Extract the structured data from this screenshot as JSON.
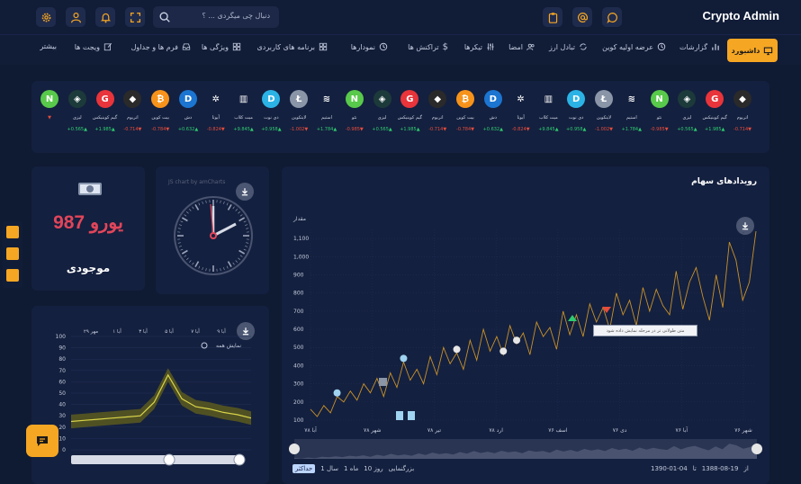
{
  "header": {
    "brand": "Crypto Admin",
    "search_placeholder": "دنبال چی میگردی ... ؟"
  },
  "nav": {
    "active": "داشبورد",
    "items": [
      "گزارشات",
      "عرضه اولیه کوین",
      "تبادل ارز",
      "امضا",
      "تیکرها",
      "تراکنش ها",
      "نمودارها",
      "برنامه های کاربردی",
      "ویژگی ها",
      "فرم ها و جداول",
      "ویجت ها",
      "بیشتر"
    ]
  },
  "coins": [
    {
      "name": "اتریوم",
      "change": "-0.714",
      "dir": "dn",
      "color": "#2a2a2a",
      "glyph": "◆"
    },
    {
      "name": "گیم کوینیکس",
      "change": "+1.985",
      "dir": "up",
      "color": "#e8343a",
      "glyph": "G"
    },
    {
      "name": "لیزی",
      "change": "+0.565",
      "dir": "up",
      "color": "#1c3a3a",
      "glyph": "◈"
    },
    {
      "name": "نئو",
      "change": "-0.985",
      "dir": "dn",
      "color": "#58c94a",
      "glyph": "N"
    },
    {
      "name": "استیم",
      "change": "+1.784",
      "dir": "up",
      "color": "#14203f",
      "glyph": "≋"
    },
    {
      "name": "لایتکوین",
      "change": "-1.002",
      "dir": "dn",
      "color": "#8a95a8",
      "glyph": "Ł"
    },
    {
      "name": "دی نوت",
      "change": "+0.958",
      "dir": "up",
      "color": "#2bb3e6",
      "glyph": "D"
    },
    {
      "name": "میت کلاب",
      "change": "+9.845",
      "dir": "up",
      "color": "#14203f",
      "glyph": "▥"
    },
    {
      "name": "آیوتا",
      "change": "-0.824",
      "dir": "dn",
      "color": "#14203f",
      "glyph": "✲"
    },
    {
      "name": "دش",
      "change": "+0.632",
      "dir": "up",
      "color": "#1b75d1",
      "glyph": "D"
    },
    {
      "name": "بیت کوین",
      "change": "-0.784",
      "dir": "dn",
      "color": "#f7931a",
      "glyph": "₿"
    },
    {
      "name": "اتریوم",
      "change": "-0.714",
      "dir": "dn",
      "color": "#2a2a2a",
      "glyph": "◆"
    },
    {
      "name": "گیم کوینیکس",
      "change": "+1.985",
      "dir": "up",
      "color": "#e8343a",
      "glyph": "G"
    },
    {
      "name": "لیزی",
      "change": "+0.565",
      "dir": "up",
      "color": "#1c3a3a",
      "glyph": "◈"
    },
    {
      "name": "نئو",
      "change": "-0.985",
      "dir": "dn",
      "color": "#58c94a",
      "glyph": "N"
    },
    {
      "name": "استیم",
      "change": "+1.784",
      "dir": "up",
      "color": "#14203f",
      "glyph": "≋"
    },
    {
      "name": "لایتکوین",
      "change": "-1.002",
      "dir": "dn",
      "color": "#8a95a8",
      "glyph": "Ł"
    },
    {
      "name": "دی نوت",
      "change": "+0.958",
      "dir": "up",
      "color": "#2bb3e6",
      "glyph": "D"
    },
    {
      "name": "میت کلاب",
      "change": "+9.845",
      "dir": "up",
      "color": "#14203f",
      "glyph": "▥"
    },
    {
      "name": "آیوتا",
      "change": "-0.824",
      "dir": "dn",
      "color": "#14203f",
      "glyph": "✲"
    },
    {
      "name": "دش",
      "change": "+0.632",
      "dir": "up",
      "color": "#1b75d1",
      "glyph": "D"
    },
    {
      "name": "بیت کوین",
      "change": "-0.784",
      "dir": "dn",
      "color": "#f7931a",
      "glyph": "₿"
    },
    {
      "name": "اتریوم",
      "change": "-0.714",
      "dir": "dn",
      "color": "#2a2a2a",
      "glyph": "◆"
    },
    {
      "name": "گیم کوینیکس",
      "change": "+1.985",
      "dir": "up",
      "color": "#e8343a",
      "glyph": "G"
    },
    {
      "name": "لیزی",
      "change": "+0.565",
      "dir": "up",
      "color": "#1c3a3a",
      "glyph": "◈"
    },
    {
      "name": "",
      "change": "",
      "dir": "dn",
      "color": "#58c94a",
      "glyph": "N"
    }
  ],
  "wallet": {
    "amount": "987 یورو",
    "label": "موجودی"
  },
  "clock": {
    "caption": "JS chart by amCharts"
  },
  "small_chart": {
    "legend": "نمایش همه",
    "x_labels": [
      "مهر ۲۹",
      "آبا ۱",
      "آبا ۳",
      "آبا ۵",
      "آبا ۷",
      "آبا ۹"
    ]
  },
  "main_chart": {
    "title": "رویدادهای سهام",
    "y_title": "مقدار",
    "tooltip": "متن طولانی تر در مرحله نمایش داده شود",
    "zoom_label": "بزرگنمایی",
    "zoom_options": [
      "10 روز",
      "1 ماه",
      "1 سال",
      "حداکثر"
    ],
    "range_from": "1390-01-04",
    "range_to": "1388-08-19",
    "range_prefix": "از",
    "range_mid": "تا"
  },
  "chart_data": [
    {
      "type": "line",
      "title": "رویدادهای سهام",
      "ylabel": "مقدار",
      "x_ticks": [
        "شهر ۷۶",
        "آبا ۷۶",
        "دی ۷۶",
        "اسف ۷۶",
        "ارد ۷۸",
        "تیر ۷۸",
        "شهر ۷۸",
        "آبا ۷۸"
      ],
      "y_ticks": [
        100,
        200,
        300,
        400,
        500,
        600,
        700,
        800,
        900,
        1000,
        1100
      ],
      "ylim": [
        100,
        1150
      ],
      "values": [
        160,
        120,
        180,
        140,
        230,
        200,
        260,
        210,
        300,
        250,
        330,
        230,
        360,
        280,
        420,
        320,
        380,
        300,
        450,
        350,
        500,
        410,
        470,
        380,
        540,
        430,
        600,
        480,
        560,
        460,
        620,
        520,
        580,
        460,
        640,
        560,
        610,
        490,
        700,
        570,
        680,
        560,
        740,
        640,
        720,
        600,
        800,
        680,
        760,
        620,
        830,
        700,
        820,
        730,
        680,
        920,
        710,
        860,
        940,
        780,
        650,
        900,
        720,
        1080,
        980,
        760,
        860,
        1140
      ]
    },
    {
      "type": "line",
      "x_ticks": [
        "مهر ۲۹",
        "آبا ۱",
        "آبا ۳",
        "آبا ۵",
        "آبا ۷",
        "آبا ۹"
      ],
      "y_ticks": [
        0,
        10,
        20,
        30,
        40,
        50,
        60,
        70,
        80,
        90,
        100
      ],
      "ylim": [
        0,
        100
      ],
      "series": [
        {
          "values": [
            25,
            26,
            27,
            28,
            29,
            30,
            42,
            66,
            45,
            38,
            36,
            33,
            31,
            28
          ]
        }
      ]
    }
  ]
}
